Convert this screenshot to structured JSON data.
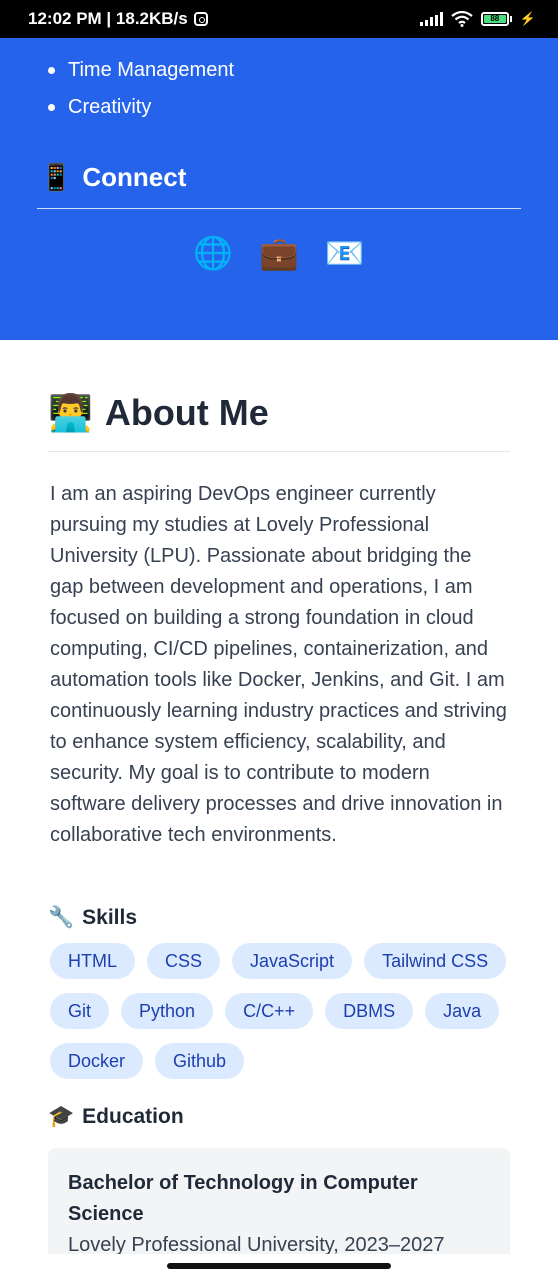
{
  "status_bar": {
    "time_speed": "12:02 PM | 18.2KB/s",
    "battery": "88"
  },
  "hobbies": [
    "Time Management",
    "Creativity"
  ],
  "connect": {
    "icon": "📱",
    "title": "Connect",
    "links": [
      {
        "name": "website-icon",
        "glyph": "🌐"
      },
      {
        "name": "briefcase-icon",
        "glyph": "💼"
      },
      {
        "name": "email-icon",
        "glyph": "📧"
      }
    ]
  },
  "about": {
    "icon": "👨‍💻",
    "title": "About Me",
    "text": "I am an aspiring DevOps engineer currently pursuing my studies at Lovely Professional University (LPU). Passionate about bridging the gap between development and operations, I am focused on building a strong foundation in cloud computing, CI/CD pipelines, containerization, and automation tools like Docker, Jenkins, and Git. I am continuously learning industry practices and striving to enhance system efficiency, scalability, and security. My goal is to contribute to modern software delivery processes and drive innovation in collaborative tech environments."
  },
  "skills": {
    "icon": "🔧",
    "title": "Skills",
    "items": [
      "HTML",
      "CSS",
      "JavaScript",
      "Tailwind CSS",
      "Git",
      "Python",
      "C/C++",
      "DBMS",
      "Java",
      "Docker",
      "Github"
    ]
  },
  "education": {
    "icon": "🎓",
    "title": "Education",
    "degree": "Bachelor of Technology in Computer Science",
    "school": "Lovely Professional University, 2023–2027"
  }
}
